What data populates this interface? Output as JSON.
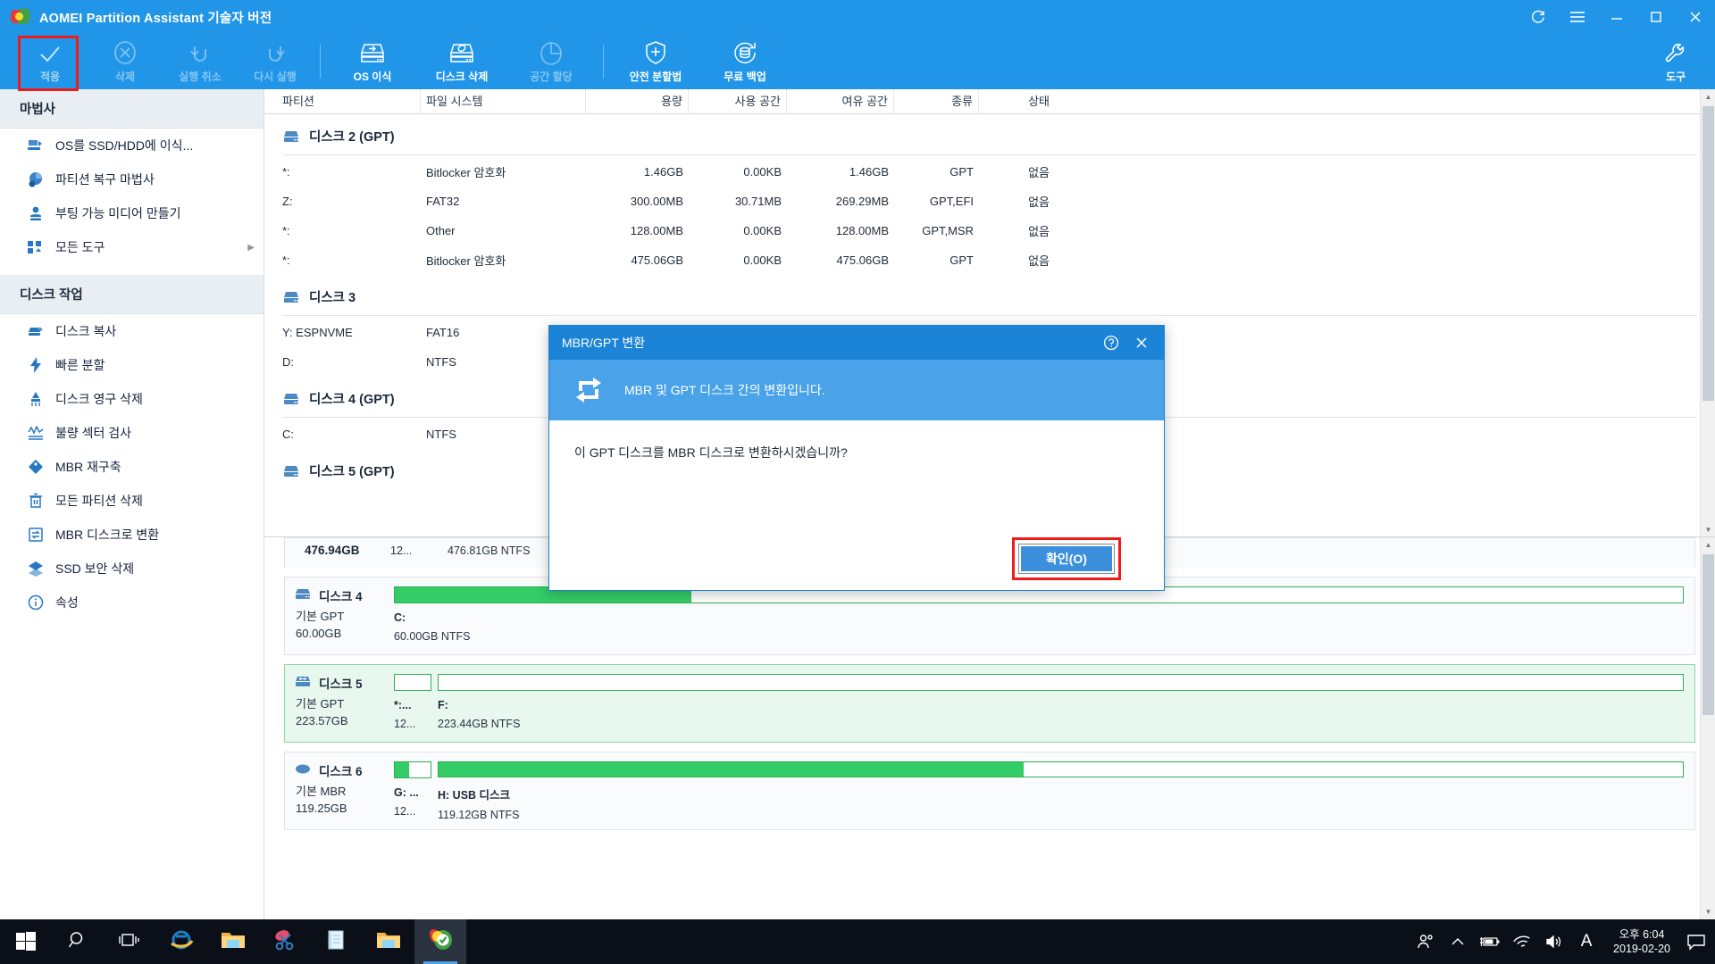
{
  "window": {
    "title": "AOMEI Partition Assistant 기술자 버전",
    "controls": {
      "refresh": "refresh-icon",
      "menu": "menu-icon",
      "minimize": "minimize-icon",
      "maximize": "maximize-icon",
      "close": "close-icon"
    },
    "accent": "#2196e8",
    "highlight_color": "#ef1b1b"
  },
  "toolbar": {
    "items": [
      {
        "label": "적용",
        "icon": "check-icon",
        "disabled": false,
        "highlighted": true
      },
      {
        "label": "삭제",
        "icon": "cancel-circle-icon",
        "disabled": true,
        "highlighted": false
      },
      {
        "label": "실행 취소",
        "icon": "undo-icon",
        "disabled": true,
        "highlighted": false
      },
      {
        "label": "다시 실행",
        "icon": "redo-icon",
        "disabled": true,
        "highlighted": false
      },
      {
        "label": "OS 이식",
        "icon": "disk-migrate-icon",
        "disabled": false,
        "highlighted": false
      },
      {
        "label": "디스크 삭제",
        "icon": "disk-wipe-icon",
        "disabled": false,
        "highlighted": false
      },
      {
        "label": "공간 할당",
        "icon": "pie-chart-icon",
        "disabled": true,
        "highlighted": false
      },
      {
        "label": "안전 분할법",
        "icon": "shield-plus-icon",
        "disabled": false,
        "highlighted": false
      },
      {
        "label": "무료 백업",
        "icon": "backup-refresh-icon",
        "disabled": false,
        "highlighted": false
      }
    ],
    "tools_button": {
      "label": "도구",
      "icon": "wrench-icon"
    }
  },
  "sidebar": {
    "sections": [
      {
        "header": "마법사",
        "items": [
          {
            "label": "OS를 SSD/HDD에 이식...",
            "icon": "os-migrate-icon",
            "submenu": false
          },
          {
            "label": "파티션 복구 마법사",
            "icon": "partition-recover-icon",
            "submenu": false
          },
          {
            "label": "부팅 가능 미디어 만들기",
            "icon": "bootable-media-icon",
            "submenu": false
          },
          {
            "label": "모든 도구",
            "icon": "all-tools-icon",
            "submenu": true
          }
        ]
      },
      {
        "header": "디스크 작업",
        "items": [
          {
            "label": "디스크 복사",
            "icon": "disk-copy-icon",
            "submenu": false
          },
          {
            "label": "빠른 분할",
            "icon": "quick-partition-icon",
            "submenu": false
          },
          {
            "label": "디스크 영구 삭제",
            "icon": "disk-erase-icon",
            "submenu": false
          },
          {
            "label": "불량 섹터 검사",
            "icon": "bad-sector-icon",
            "submenu": false
          },
          {
            "label": "MBR 재구축",
            "icon": "mbr-rebuild-icon",
            "submenu": false
          },
          {
            "label": "모든 파티션 삭제",
            "icon": "delete-all-icon",
            "submenu": false
          },
          {
            "label": "MBR 디스크로 변환",
            "icon": "convert-mbr-icon",
            "submenu": false
          },
          {
            "label": "SSD 보안 삭제",
            "icon": "ssd-secure-erase-icon",
            "submenu": false
          },
          {
            "label": "속성",
            "icon": "properties-icon",
            "submenu": false
          }
        ]
      }
    ]
  },
  "table": {
    "columns": [
      "파티션",
      "파일 시스템",
      "용량",
      "사용 공간",
      "여유 공간",
      "종류",
      "상태"
    ],
    "groups": [
      {
        "disk": "디스크 2 (GPT)",
        "icon": "hdd-icon",
        "rows": [
          {
            "partition": "*:",
            "fs": "Bitlocker 암호화",
            "capacity": "1.46GB",
            "used": "0.00KB",
            "free": "1.46GB",
            "kind": "GPT",
            "status": "없음"
          },
          {
            "partition": "Z:",
            "fs": "FAT32",
            "capacity": "300.00MB",
            "used": "30.71MB",
            "free": "269.29MB",
            "kind": "GPT,EFI",
            "status": "없음"
          },
          {
            "partition": "*:",
            "fs": "Other",
            "capacity": "128.00MB",
            "used": "0.00KB",
            "free": "128.00MB",
            "kind": "GPT,MSR",
            "status": "없음"
          },
          {
            "partition": "*:",
            "fs": "Bitlocker 암호화",
            "capacity": "475.06GB",
            "used": "0.00KB",
            "free": "475.06GB",
            "kind": "GPT",
            "status": "없음"
          }
        ]
      },
      {
        "disk": "디스크 3",
        "icon": "hdd-icon",
        "rows": [
          {
            "partition": "Y: ESPNVME",
            "fs": "FAT16",
            "capacity": "",
            "used": "",
            "free": "",
            "kind": "",
            "status": ""
          },
          {
            "partition": "D:",
            "fs": "NTFS",
            "capacity": "",
            "used": "",
            "free": "",
            "kind": "",
            "status": ""
          }
        ]
      },
      {
        "disk": "디스크 4 (GPT)",
        "icon": "hdd-icon",
        "rows": [
          {
            "partition": "C:",
            "fs": "NTFS",
            "capacity": "",
            "used": "",
            "free": "",
            "kind": "",
            "status": ""
          }
        ]
      },
      {
        "disk": "디스크 5 (GPT)",
        "icon": "hdd-icon",
        "rows": []
      }
    ]
  },
  "graph": {
    "cut_row": {
      "size": "476.94GB",
      "small": "12...",
      "label": "476.81GB NTFS"
    },
    "disks": [
      {
        "name": "디스크 4",
        "icon": "hdd-icon",
        "type": "기본 GPT",
        "size": "60.00GB",
        "selected": false,
        "partitions": [
          {
            "label": "C:",
            "size": "60.00GB NTFS",
            "fill_pct": 23,
            "width": "grow"
          }
        ]
      },
      {
        "name": "디스크 5",
        "icon": "hdd-removable-icon",
        "type": "기본 GPT",
        "size": "223.57GB",
        "selected": true,
        "partitions": [
          {
            "label": "*:...",
            "size": "12...",
            "fill_pct": 0,
            "width": "small"
          },
          {
            "label": "F:",
            "size": "223.44GB NTFS",
            "fill_pct": 0,
            "width": "grow"
          }
        ]
      },
      {
        "name": "디스크 6",
        "icon": "usb-disk-icon",
        "type": "기본 MBR",
        "size": "119.25GB",
        "selected": false,
        "partitions": [
          {
            "label": "G: ...",
            "size": "12...",
            "fill_pct": 40,
            "width": "small"
          },
          {
            "label": "H: USB 디스크",
            "size": "119.12GB NTFS",
            "fill_pct": 47,
            "width": "grow"
          }
        ]
      }
    ]
  },
  "modal": {
    "title": "MBR/GPT 변환",
    "help_icon": "help-circle-icon",
    "close_icon": "close-icon",
    "banner_icon": "convert-arrows-icon",
    "banner_text": "MBR 및 GPT 디스크 간의 변환입니다.",
    "message": "이 GPT 디스크를 MBR 디스크로 변환하시겠습니까?",
    "ok_label": "확인(O)",
    "ok_highlighted": true
  },
  "taskbar": {
    "items": [
      {
        "name": "start-button",
        "icon": "windows-logo-icon",
        "active": false
      },
      {
        "name": "search-button",
        "icon": "search-icon",
        "active": false
      },
      {
        "name": "task-view-button",
        "icon": "task-view-icon",
        "active": false
      },
      {
        "name": "internet-explorer",
        "icon": "ie-icon",
        "active": false
      },
      {
        "name": "file-explorer",
        "icon": "folder-icon",
        "active": false
      },
      {
        "name": "snipping-tool",
        "icon": "scissors-icon",
        "active": false
      },
      {
        "name": "notepad",
        "icon": "notepad-icon",
        "active": false
      },
      {
        "name": "file-explorer-2",
        "icon": "folder-icon",
        "active": false
      },
      {
        "name": "aomei-partition-assistant",
        "icon": "aomei-icon",
        "active": true
      }
    ],
    "tray": [
      {
        "name": "people-icon"
      },
      {
        "name": "chevron-up-icon"
      },
      {
        "name": "battery-charging-icon"
      },
      {
        "name": "wifi-icon"
      },
      {
        "name": "volume-icon"
      },
      {
        "name": "ime-indicator",
        "text": "A"
      }
    ],
    "clock": {
      "time": "오후 6:04",
      "date": "2019-02-20"
    },
    "notification_icon": "notification-icon"
  }
}
